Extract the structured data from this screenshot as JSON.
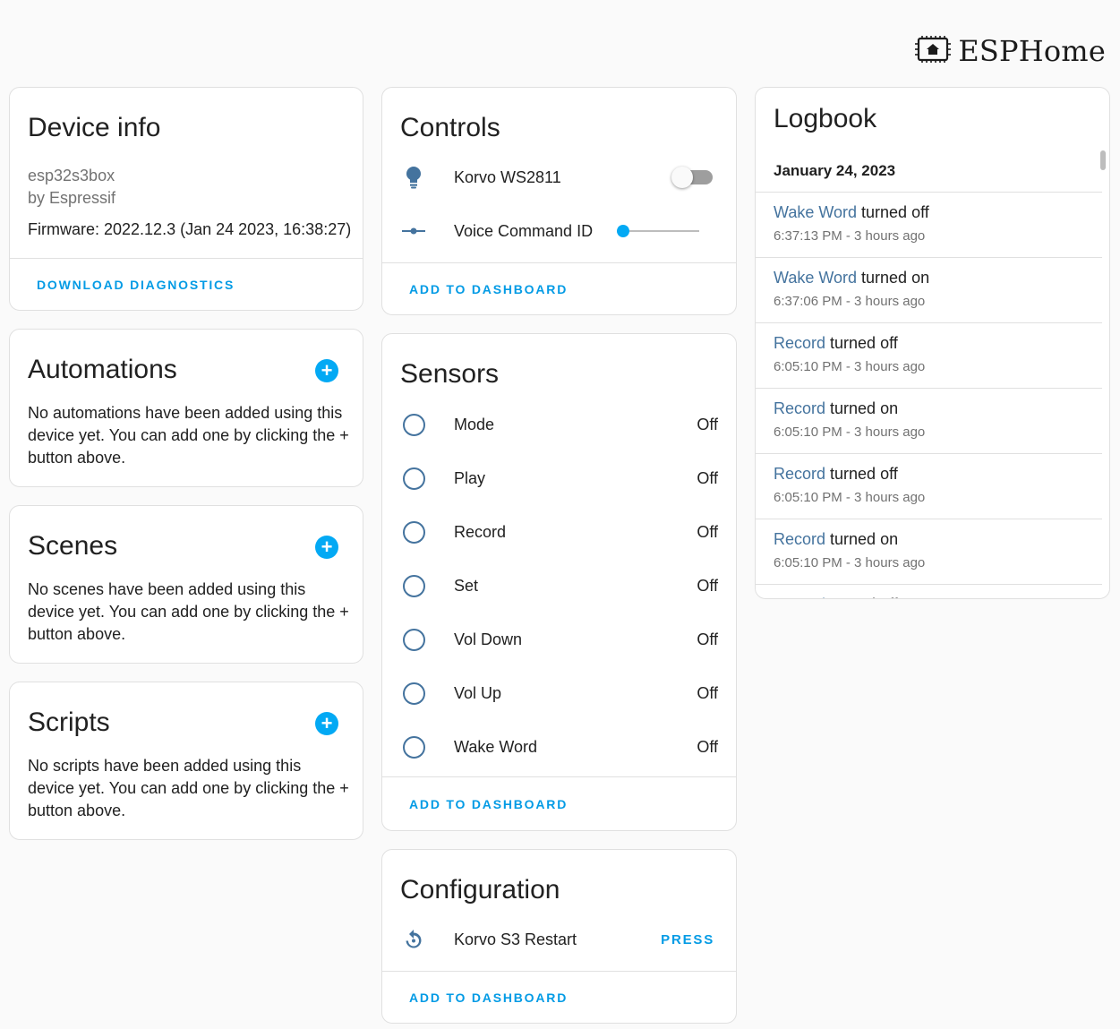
{
  "brand": {
    "name": "ESPHome",
    "logo_icon": "esphome-chip-icon"
  },
  "device_info": {
    "title": "Device info",
    "model": "esp32s3box",
    "manufacturer": "by Espressif",
    "firmware": "Firmware: 2022.12.3 (Jan 24 2023, 16:38:27)",
    "action": "DOWNLOAD DIAGNOSTICS"
  },
  "automations": {
    "title": "Automations",
    "text": "No automations have been added using this device yet. You can add one by clicking the + button above.",
    "add_icon": "plus-circle-icon"
  },
  "scenes": {
    "title": "Scenes",
    "text": "No scenes have been added using this device yet. You can add one by clicking the + button above.",
    "add_icon": "plus-circle-icon"
  },
  "scripts": {
    "title": "Scripts",
    "text": "No scripts have been added using this device yet. You can add one by clicking the + button above.",
    "add_icon": "plus-circle-icon"
  },
  "controls": {
    "title": "Controls",
    "items": [
      {
        "label": "Korvo WS2811",
        "icon": "lightbulb-icon",
        "state": "off"
      },
      {
        "label": "Voice Command ID",
        "icon": "ray-vertex-icon",
        "value": 0
      }
    ],
    "action": "ADD TO DASHBOARD"
  },
  "sensors": {
    "title": "Sensors",
    "items": [
      {
        "label": "Mode",
        "state": "Off"
      },
      {
        "label": "Play",
        "state": "Off"
      },
      {
        "label": "Record",
        "state": "Off"
      },
      {
        "label": "Set",
        "state": "Off"
      },
      {
        "label": "Vol Down",
        "state": "Off"
      },
      {
        "label": "Vol Up",
        "state": "Off"
      },
      {
        "label": "Wake Word",
        "state": "Off"
      }
    ],
    "action": "ADD TO DASHBOARD"
  },
  "configuration": {
    "title": "Configuration",
    "items": [
      {
        "label": "Korvo S3 Restart",
        "icon": "restart-icon",
        "button": "PRESS"
      }
    ],
    "action": "ADD TO DASHBOARD"
  },
  "logbook": {
    "title": "Logbook",
    "date": "January 24, 2023",
    "entries": [
      {
        "entity": "Wake Word",
        "action": " turned off",
        "time": "6:37:13 PM - 3 hours ago"
      },
      {
        "entity": "Wake Word",
        "action": " turned on",
        "time": "6:37:06 PM - 3 hours ago"
      },
      {
        "entity": "Record",
        "action": " turned off",
        "time": "6:05:10 PM - 3 hours ago"
      },
      {
        "entity": "Record",
        "action": " turned on",
        "time": "6:05:10 PM - 3 hours ago"
      },
      {
        "entity": "Record",
        "action": " turned off",
        "time": "6:05:10 PM - 3 hours ago"
      },
      {
        "entity": "Record",
        "action": " turned on",
        "time": "6:05:10 PM - 3 hours ago"
      },
      {
        "entity": "Record",
        "action": " turned off",
        "time": ""
      }
    ]
  },
  "colors": {
    "accent": "#03a9f4",
    "link": "#039be5",
    "entity": "#44739e"
  }
}
